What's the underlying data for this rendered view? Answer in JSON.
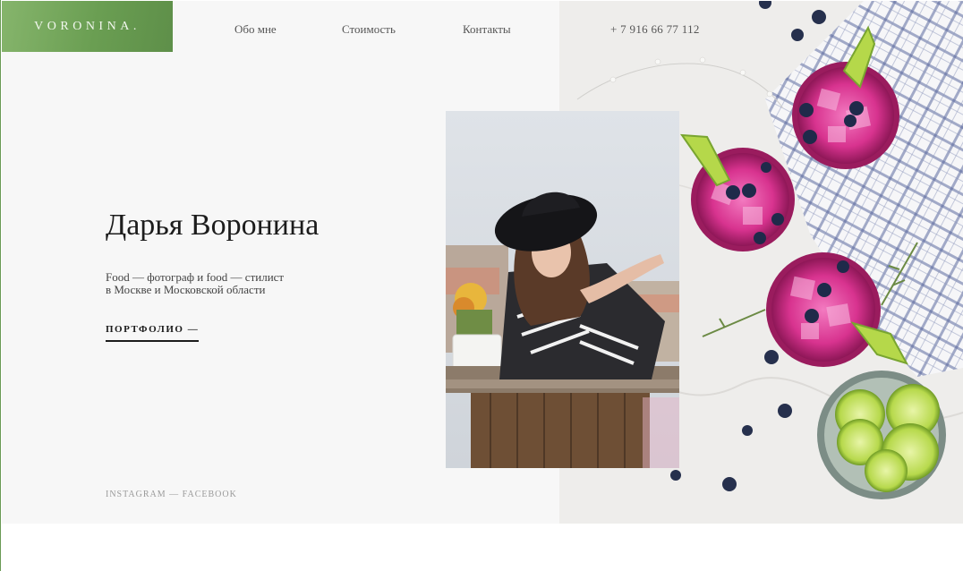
{
  "header": {
    "logo": "VORONINA.",
    "nav": [
      "Обо мне",
      "Стоимость",
      "Контакты"
    ],
    "phone": "+ 7 916 66 77 112"
  },
  "hero": {
    "name": "Дарья Воронина",
    "description_line1": "Food — фотограф и food — стилист",
    "description_line2": "в Москве и Московской области",
    "portfolio_link": "ПОРТФОЛИО —",
    "social_instagram": "INSTAGRAM",
    "social_separator": " — ",
    "social_facebook": "FACEBOOK"
  },
  "colors": {
    "brand_green": "#6a9e52",
    "hero_background": "#f7f7f7",
    "text_dark": "#1c1c1c"
  }
}
